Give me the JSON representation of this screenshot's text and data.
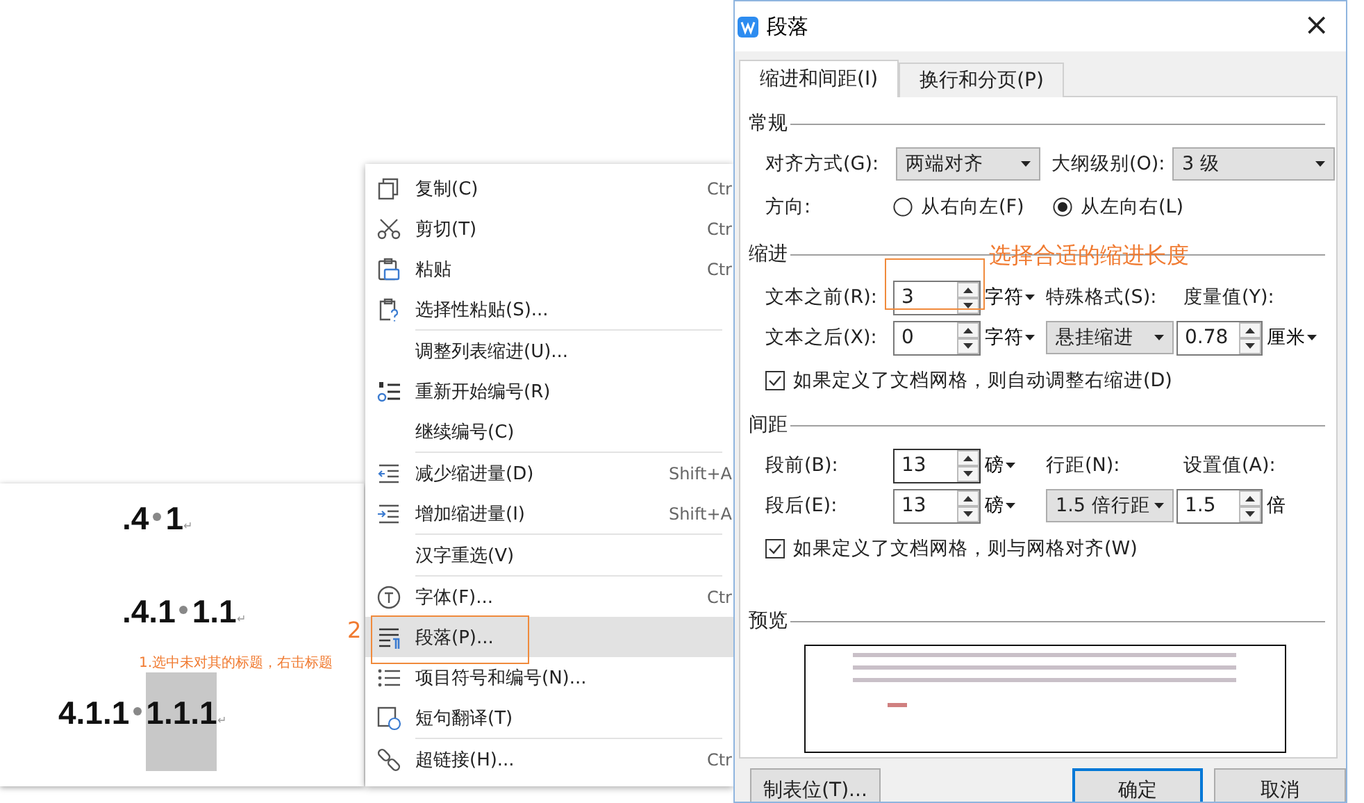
{
  "document": {
    "headings": [
      {
        "number": ".4",
        "title": "1",
        "mark": "↵",
        "selected": false
      },
      {
        "number": ".4.1",
        "title": "1.1",
        "mark": "↵",
        "selected": false
      },
      {
        "number": "4.1.1",
        "title": "1.1.1",
        "mark": "↵",
        "selected": true
      }
    ],
    "annotation": "1.选中未对其的标题，右击标题"
  },
  "context_menu": {
    "annotation": "2",
    "items": [
      {
        "kind": "copy",
        "label": "复制(C)",
        "shortcut": "Ctr",
        "separator_after": false,
        "highlighted": false
      },
      {
        "kind": "cut",
        "label": "剪切(T)",
        "shortcut": "Ctr",
        "separator_after": false,
        "highlighted": false
      },
      {
        "kind": "paste",
        "label": "粘贴",
        "shortcut": "Ctr",
        "separator_after": false,
        "highlighted": false
      },
      {
        "kind": "paste-special",
        "label": "选择性粘贴(S)...",
        "separator_after": true,
        "highlighted": false
      },
      {
        "kind": "none",
        "label": "调整列表缩进(U)...",
        "separator_after": false,
        "highlighted": false
      },
      {
        "kind": "restart-numbering",
        "label": "重新开始编号(R)",
        "separator_after": false,
        "highlighted": false
      },
      {
        "kind": "none",
        "label": "继续编号(C)",
        "separator_after": true,
        "highlighted": false
      },
      {
        "kind": "decrease-indent",
        "label": "减少缩进量(D)",
        "shortcut": "Shift+A",
        "separator_after": false,
        "highlighted": false
      },
      {
        "kind": "increase-indent",
        "label": "增加缩进量(I)",
        "shortcut": "Shift+A",
        "separator_after": true,
        "highlighted": false
      },
      {
        "kind": "none",
        "label": "汉字重选(V)",
        "separator_after": true,
        "highlighted": false
      },
      {
        "kind": "font",
        "label": "字体(F)...",
        "shortcut": "Ctr",
        "separator_after": false,
        "highlighted": false
      },
      {
        "kind": "paragraph",
        "label": "段落(P)...",
        "separator_after": false,
        "highlighted": true
      },
      {
        "kind": "bullets",
        "label": "项目符号和编号(N)...",
        "separator_after": false,
        "highlighted": false
      },
      {
        "kind": "translate",
        "label": "短句翻译(T)",
        "separator_after": true,
        "highlighted": false
      },
      {
        "kind": "link",
        "label": "超链接(H)...",
        "shortcut": "Ctr",
        "separator_after": false,
        "highlighted": false
      }
    ]
  },
  "dialog": {
    "title": "段落",
    "close": "×",
    "tabs": [
      {
        "label": "缩进和间距(I)",
        "selected": true
      },
      {
        "label": "换行和分页(P)",
        "selected": false
      }
    ],
    "general": {
      "heading": "常规",
      "alignment": {
        "label": "对齐方式(G):",
        "value": "两端对齐"
      },
      "outline_level": {
        "label": "大纲级别(O):",
        "value": "3 级"
      },
      "direction": {
        "label": "方向:",
        "options": [
          {
            "label": "从右向左(F)",
            "selected": false
          },
          {
            "label": "从左向右(L)",
            "selected": true
          }
        ]
      }
    },
    "indent": {
      "heading": "缩进",
      "before": {
        "label": "文本之前(R):",
        "value": "3",
        "unit": "字符"
      },
      "after": {
        "label": "文本之后(X):",
        "value": "0",
        "unit": "字符"
      },
      "special_format": {
        "label": "特殊格式(S):",
        "value": "悬挂缩进"
      },
      "measure": {
        "label": "度量值(Y):",
        "value": "0.78",
        "unit": "厘米"
      },
      "auto_adjust": {
        "label": "如果定义了文档网格，则自动调整右缩进(D)",
        "checked": true
      }
    },
    "spacing": {
      "heading": "间距",
      "before": {
        "label": "段前(B):",
        "value": "13",
        "unit": "磅"
      },
      "after": {
        "label": "段后(E):",
        "value": "13",
        "unit": "磅"
      },
      "line_spacing": {
        "label": "行距(N):",
        "value": "1.5 倍行距"
      },
      "setting": {
        "label": "设置值(A):",
        "value": "1.5",
        "unit": "倍"
      },
      "snap_to_grid": {
        "label": "如果定义了文档网格，则与网格对齐(W)",
        "checked": true
      }
    },
    "preview": {
      "heading": "预览"
    },
    "annotation": "选择合适的缩进长度",
    "buttons": [
      {
        "label": "制表位(T)...",
        "default": false
      },
      {
        "label": "确定",
        "default": true
      },
      {
        "label": "取消",
        "default": false
      }
    ]
  }
}
